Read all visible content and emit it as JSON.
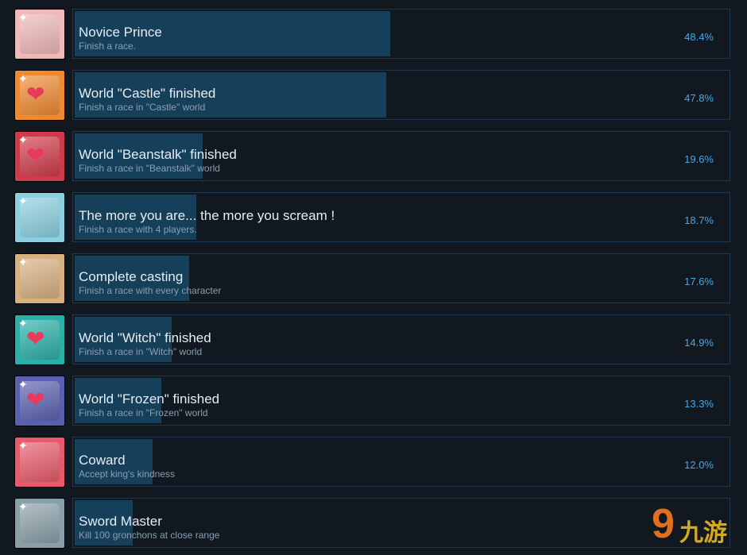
{
  "achievements": [
    {
      "title": "Novice Prince",
      "desc": "Finish a race.",
      "percent": "48.4%",
      "value": 48.4,
      "icon": "novice-prince-icon",
      "color": "#f0b8b8"
    },
    {
      "title": "World \"Castle\" finished",
      "desc": "Finish a race in \"Castle\" world",
      "percent": "47.8%",
      "value": 47.8,
      "icon": "castle-key-icon",
      "color": "#f08a30"
    },
    {
      "title": "World \"Beanstalk\" finished",
      "desc": "Finish a race in \"Beanstalk\" world",
      "percent": "19.6%",
      "value": 19.6,
      "icon": "beanstalk-key-icon",
      "color": "#d03a4a"
    },
    {
      "title": "The more you are... the more you scream !",
      "desc": "Finish a race with 4 players.",
      "percent": "18.7%",
      "value": 18.7,
      "icon": "four-players-icon",
      "color": "#8ad0e0"
    },
    {
      "title": "Complete casting",
      "desc": "Finish a race with every character",
      "percent": "17.6%",
      "value": 17.6,
      "icon": "casting-icon",
      "color": "#d8b080"
    },
    {
      "title": "World \"Witch\" finished",
      "desc": "Finish a race in \"Witch\" world",
      "percent": "14.9%",
      "value": 14.9,
      "icon": "witch-key-icon",
      "color": "#2ab0a8"
    },
    {
      "title": "World \"Frozen\" finished",
      "desc": "Finish a race in \"Frozen\" world",
      "percent": "13.3%",
      "value": 13.3,
      "icon": "frozen-key-icon",
      "color": "#5a60b0"
    },
    {
      "title": "Coward",
      "desc": "Accept king's kindness",
      "percent": "12.0%",
      "value": 12.0,
      "icon": "coward-icon",
      "color": "#e85a6a"
    },
    {
      "title": "Sword Master",
      "desc": "Kill 100 gronchons at close range",
      "percent": "",
      "value": 8.9,
      "icon": "sword-icon",
      "color": "#8aa0a8"
    }
  ],
  "watermark": {
    "logo_text": "九游"
  }
}
